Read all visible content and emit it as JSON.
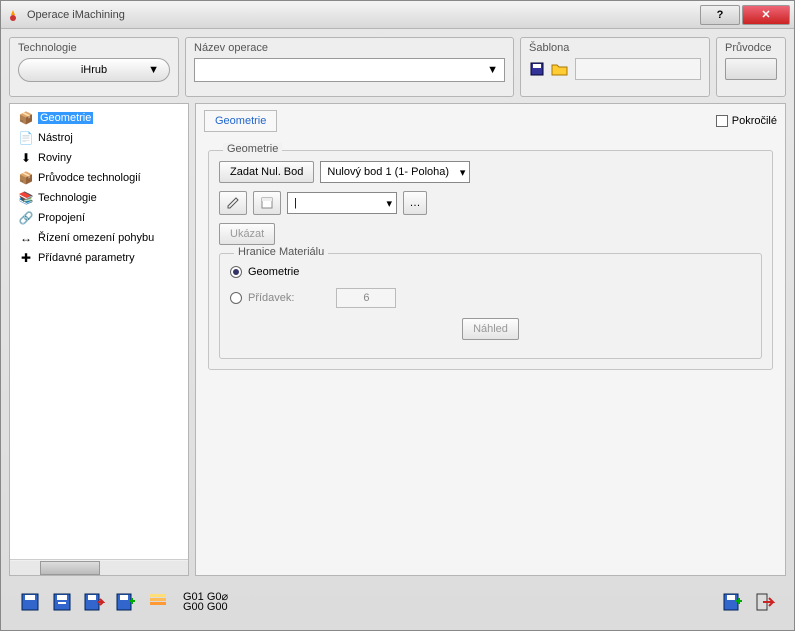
{
  "window": {
    "title": "Operace iMachining"
  },
  "top": {
    "technologie_label": "Technologie",
    "technologie_value": "iHrub",
    "nazev_label": "Název operace",
    "sablona_label": "Šablona",
    "pruvodce_label": "Průvodce"
  },
  "tree": {
    "items": [
      {
        "label": "Geometrie",
        "icon": "📦",
        "sel": true
      },
      {
        "label": "Nástroj",
        "icon": "📄"
      },
      {
        "label": "Roviny",
        "icon": "⬇"
      },
      {
        "label": "Průvodce technologií",
        "icon": "📦"
      },
      {
        "label": "Technologie",
        "icon": "📚"
      },
      {
        "label": "Propojení",
        "icon": "🔗"
      },
      {
        "label": "Řízení omezení pohybu",
        "icon": "↔"
      },
      {
        "label": "Přídavné parametry",
        "icon": "✚"
      }
    ]
  },
  "right": {
    "tab": "Geometrie",
    "pokrocile": "Pokročilé",
    "legend": "Geometrie",
    "zadat_btn": "Zadat Nul. Bod",
    "nulovy": "Nulový bod 1 (1- Poloha)",
    "ukazat": "Ukázat",
    "hranice_legend": "Hranice Materiálu",
    "r_geom": "Geometrie",
    "r_pridavek": "Přídavek:",
    "pridavek_val": "6",
    "nahled": "Náhled"
  },
  "footer": {
    "g1": "G01  G0⌀",
    "g2": "G00  G00"
  }
}
